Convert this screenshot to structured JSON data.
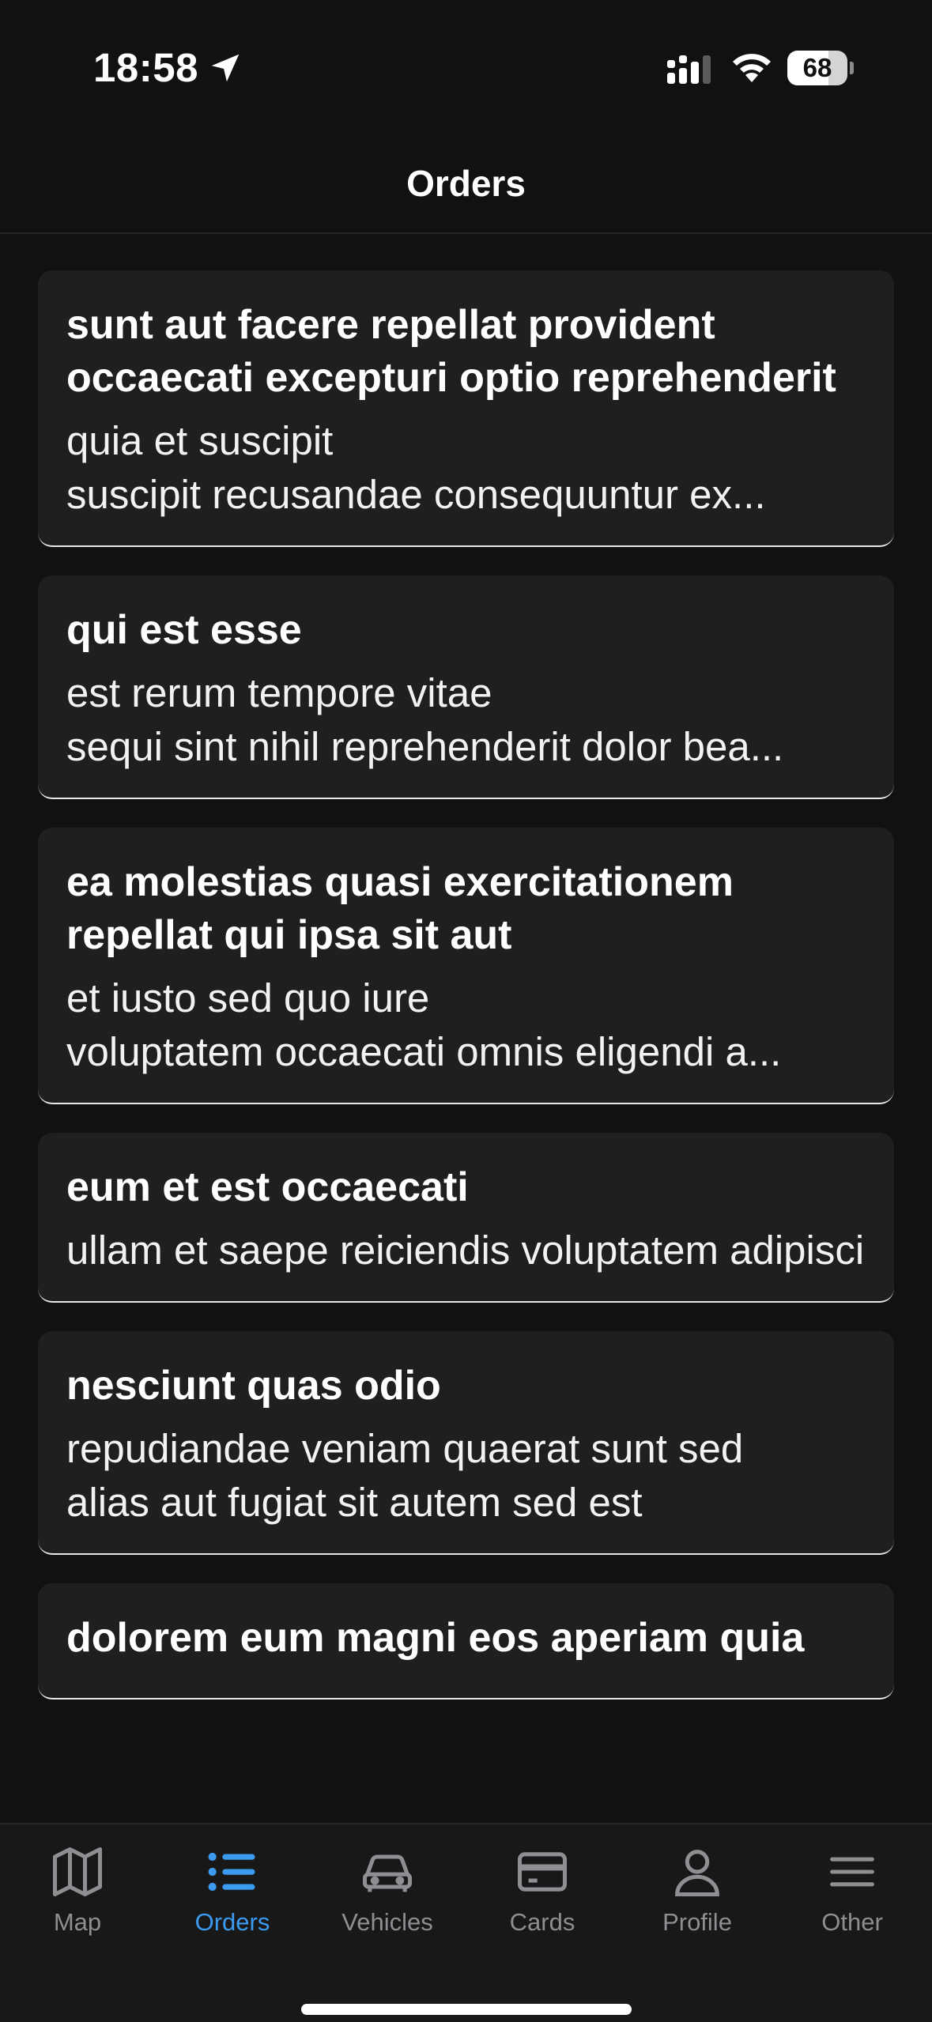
{
  "status_bar": {
    "time": "18:58",
    "battery_level": "68",
    "battery_fraction": 0.68
  },
  "header": {
    "title": "Orders"
  },
  "orders": [
    {
      "title": "sunt aut facere repellat provident occaecati excepturi optio reprehenderit",
      "body": "quia et suscipit\nsuscipit recusandae consequuntur ex..."
    },
    {
      "title": "qui est esse",
      "body": "est rerum tempore vitae\nsequi sint nihil reprehenderit dolor bea..."
    },
    {
      "title": "ea molestias quasi exercitationem repellat qui ipsa sit aut",
      "body": "et iusto sed quo iure\nvoluptatem occaecati omnis eligendi a..."
    },
    {
      "title": "eum et est occaecati",
      "body": "ullam et saepe reiciendis voluptatem adipisci"
    },
    {
      "title": "nesciunt quas odio",
      "body": "repudiandae veniam quaerat sunt sed\nalias aut fugiat sit autem sed est"
    },
    {
      "title": "dolorem eum magni eos aperiam quia",
      "body": ""
    }
  ],
  "tabs": [
    {
      "label": "Map",
      "icon": "map-icon",
      "active": false
    },
    {
      "label": "Orders",
      "icon": "list-icon",
      "active": true
    },
    {
      "label": "Vehicles",
      "icon": "car-icon",
      "active": false
    },
    {
      "label": "Cards",
      "icon": "credit-card-icon",
      "active": false
    },
    {
      "label": "Profile",
      "icon": "person-icon",
      "active": false
    },
    {
      "label": "Other",
      "icon": "menu-icon",
      "active": false
    }
  ],
  "colors": {
    "background": "#111111",
    "card": "#1f1f20",
    "accent": "#3a9bf0",
    "inactive": "#8e8e93"
  }
}
